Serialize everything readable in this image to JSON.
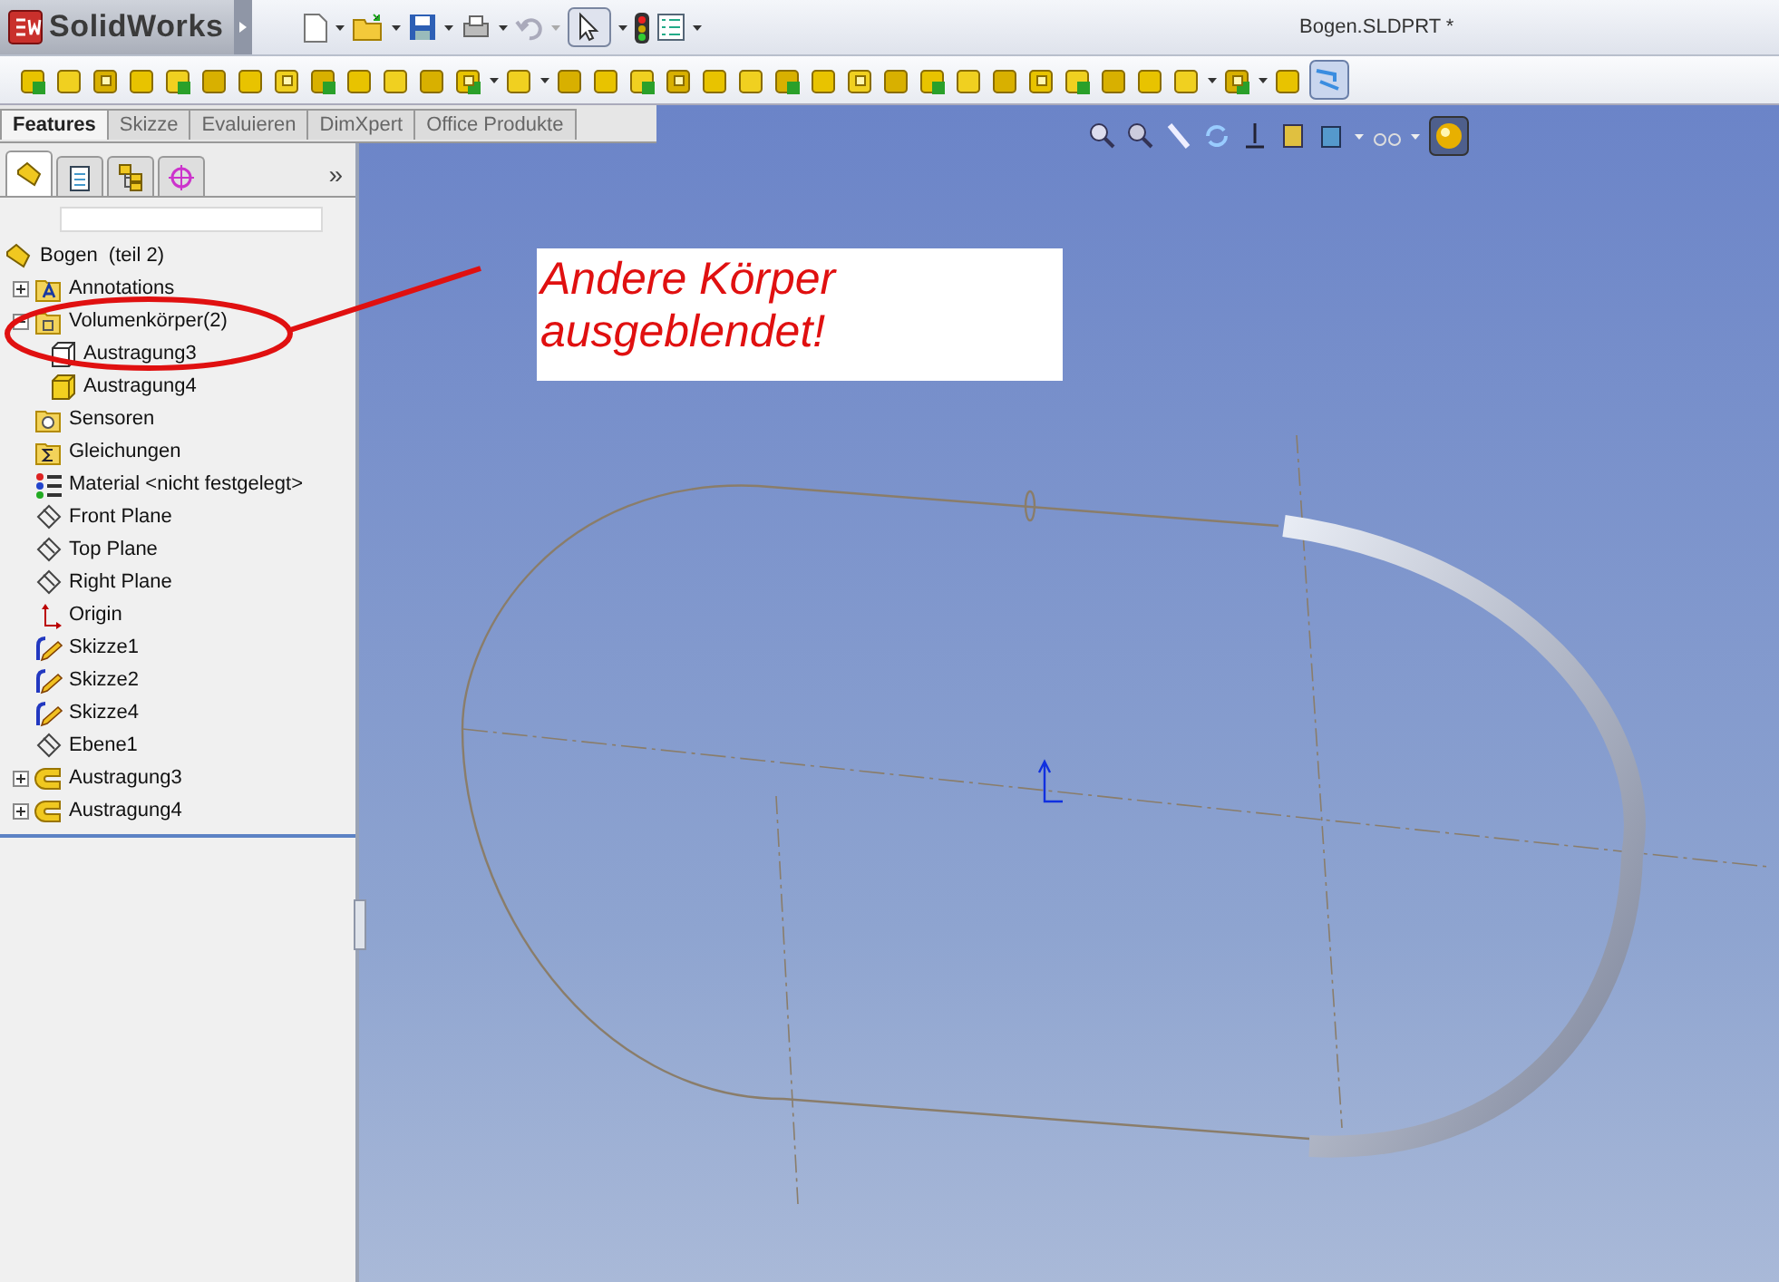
{
  "title_bar": {
    "app_name": "SolidWorks",
    "document_title": "Bogen.SLDPRT *"
  },
  "tabs": [
    {
      "label": "Features",
      "selected": true
    },
    {
      "label": "Skizze",
      "selected": false
    },
    {
      "label": "Evaluieren",
      "selected": false
    },
    {
      "label": "DimXpert",
      "selected": false
    },
    {
      "label": "Office Produkte",
      "selected": false
    }
  ],
  "panel_tabs": [
    {
      "kind": "feature",
      "selected": true
    },
    {
      "kind": "property",
      "selected": false
    },
    {
      "kind": "config",
      "selected": false
    },
    {
      "kind": "target",
      "selected": false
    }
  ],
  "panel_more": "»",
  "tree": {
    "root": "Bogen  (teil 2)",
    "items": [
      {
        "label": "Annotations",
        "kind": "annotation",
        "expanded": false
      },
      {
        "label": "Volumenkörper(2)",
        "kind": "bodies",
        "expanded": true,
        "children": [
          {
            "label": "Austragung3",
            "hidden": true
          },
          {
            "label": "Austragung4",
            "hidden": false
          }
        ]
      },
      {
        "label": "Sensoren",
        "kind": "sensor"
      },
      {
        "label": "Gleichungen",
        "kind": "equation"
      },
      {
        "label": "Material <nicht festgelegt>",
        "kind": "material"
      },
      {
        "label": "Front Plane",
        "kind": "plane"
      },
      {
        "label": "Top Plane",
        "kind": "plane"
      },
      {
        "label": "Right Plane",
        "kind": "plane"
      },
      {
        "label": "Origin",
        "kind": "origin"
      },
      {
        "label": "Skizze1",
        "kind": "sketch"
      },
      {
        "label": "Skizze2",
        "kind": "sketch"
      },
      {
        "label": "Skizze4",
        "kind": "sketch"
      },
      {
        "label": "Ebene1",
        "kind": "plane"
      },
      {
        "label": "Austragung3",
        "kind": "extrude",
        "expanded": false
      },
      {
        "label": "Austragung4",
        "kind": "extrude",
        "expanded": false
      }
    ]
  },
  "callout": {
    "text": "Andere Körper\nausgeblendet!"
  }
}
